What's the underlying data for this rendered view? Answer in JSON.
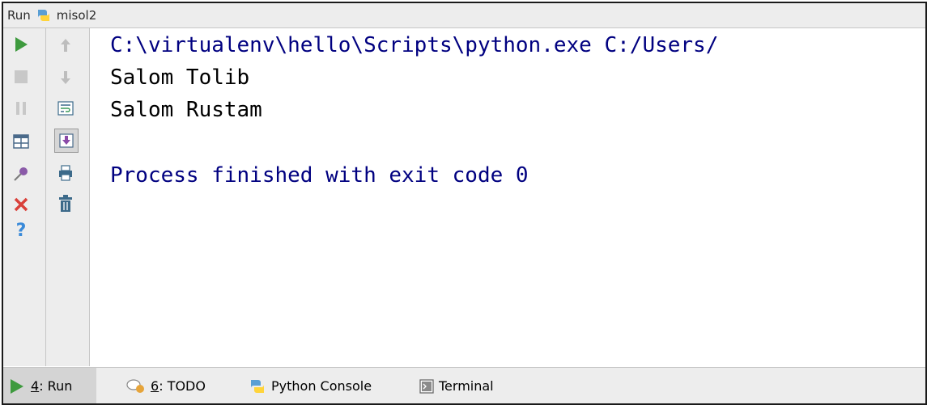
{
  "title_bar": {
    "run_label": "Run",
    "config_icon": "python-icon",
    "config_name": "misol2"
  },
  "left_toolbar": {
    "column1": [
      {
        "icon": "rerun-play-icon",
        "color": "#3e9a3e"
      },
      {
        "icon": "stop-icon",
        "color": "#c8c8c8"
      },
      {
        "icon": "pause-icon",
        "color": "#c8c8c8"
      },
      {
        "icon": "restore-layout-icon",
        "color": "#4a6a8a"
      },
      {
        "icon": "pin-icon",
        "color": "#8a5aa8"
      },
      {
        "icon": "close-icon",
        "color": "#d9403a"
      },
      {
        "icon": "help-icon",
        "color": "#3a8ad9"
      }
    ],
    "column2": [
      {
        "icon": "up-arrow-icon"
      },
      {
        "icon": "down-arrow-icon"
      },
      {
        "icon": "soft-wrap-icon"
      },
      {
        "icon": "scroll-to-end-icon"
      },
      {
        "icon": "print-icon"
      },
      {
        "icon": "trash-icon"
      }
    ]
  },
  "console": {
    "lines": [
      "C:\\virtualenv\\hello\\Scripts\\python.exe C:/Users/",
      "Salom Tolib",
      "Salom Rustam",
      "",
      "Process finished with exit code 0"
    ],
    "colors": {
      "command": "#000080",
      "output": "#000000",
      "process": "#000080"
    }
  },
  "bottom_tabs": [
    {
      "prefix": "4",
      "label": ": Run",
      "icon": "run-play-icon",
      "active": true
    },
    {
      "prefix": "6",
      "label": ": TODO",
      "icon": "todo-icon",
      "active": false
    },
    {
      "prefix": "",
      "label": "Python Console",
      "icon": "python-console-icon",
      "active": false
    },
    {
      "prefix": "",
      "label": "Terminal",
      "icon": "terminal-icon",
      "active": false
    }
  ]
}
